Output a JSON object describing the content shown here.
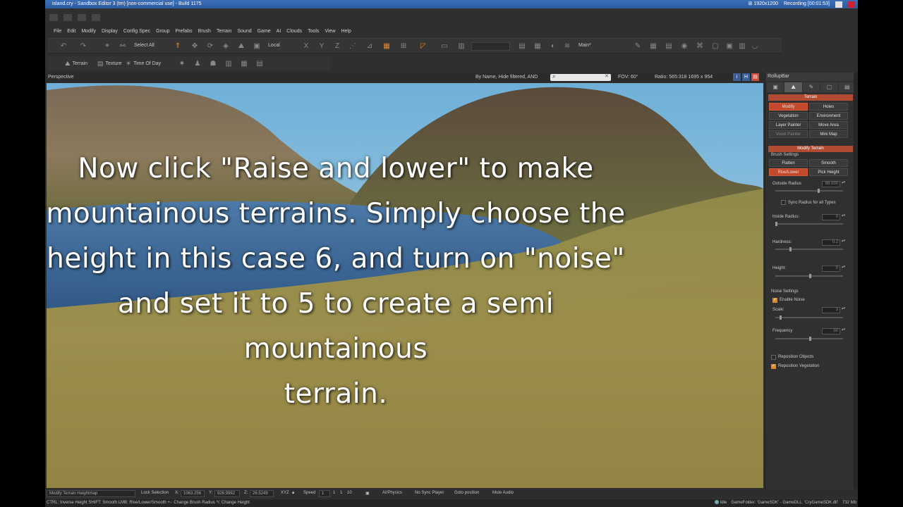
{
  "window": {
    "title": "island.cry - Sandbox Editor 3 (tm) [non-commercial use] - Build 1175",
    "resolution": "1920x1200",
    "recording": "Recording [00:01:53]"
  },
  "menu": [
    "File",
    "Edit",
    "Modify",
    "Display",
    "Config Spec",
    "Group",
    "Prefabs",
    "Brush",
    "Terrain",
    "Sound",
    "Game",
    "AI",
    "Clouds",
    "Tools",
    "View",
    "Help"
  ],
  "toolbar": {
    "select_all": "Select All",
    "coord_space": "Local",
    "layer": "Main*"
  },
  "toolbar2": {
    "terrain": "Terrain",
    "texture": "Texture",
    "time_of_day": "Time Of Day"
  },
  "viewport": {
    "mode": "Perspective",
    "filter": "By Name, Hide filtered, AND",
    "fov": "FOV:   60°",
    "ratio": "Ratio:  565:318    1695 x 954",
    "btn_i": "i",
    "btn_h": "H",
    "btn_v": "▤"
  },
  "tutorial_text": "Now click \"Raise and lower\" to make\nmountainous terrains. Simply choose the\nheight in this case 6, and turn on \"noise\"\nand set it to 5 to create a semi\nmountainous\nterrain.",
  "rollup": {
    "title": "RollupBar",
    "tabs": [
      "▣",
      "⛰",
      "✎",
      "▢",
      "▤"
    ],
    "section_terrain": "Terrain",
    "buttons_terrain": [
      "Modify",
      "Holes",
      "Vegetation",
      "Environment",
      "Layer Painter",
      "Move Area",
      "Voxel Painter",
      "Mini Map"
    ],
    "section_modify": "Modify Terrain",
    "brush_settings": "Brush Settings",
    "brush_buttons": [
      "Flatten",
      "Smooth",
      "Rise/Lower",
      "Pick Height"
    ],
    "outside_radius_label": "Outside Radius",
    "outside_radius_value": "66.000",
    "sync_radius_label": "Sync Radius for all Types",
    "inside_radius_label": "Inside Radius:",
    "inside_radius_value": "0",
    "hardness_label": "Hardness:",
    "hardness_value": "0.2",
    "height_label": "Height:",
    "height_value": "0",
    "noise_settings": "Noise Settings",
    "enable_noise": "Enable Noise",
    "scale_label": "Scale:",
    "scale_value": "3",
    "frequency_label": "Frequency",
    "frequency_value": "50",
    "reposition_objects": "Reposition Objects",
    "reposition_vegetation": "Reposition Vegetation"
  },
  "status": {
    "mode": "Modify Terrain Heightmap",
    "lock_selection": "Lock Selection",
    "x_label": "X:",
    "x_value": "1063.256",
    "y_label": "Y:",
    "y_value": "926.9982",
    "z_label": "Z:",
    "z_value": "26.5249",
    "xyz": "XYZ",
    "speed_label": "Speed",
    "speed_value": "1",
    "speed_a": "1",
    "speed_b": "10",
    "ai_physics": "AI/Physics",
    "no_sync": "No Sync Player",
    "goto": "Goto position",
    "mute": "Mute Audio"
  },
  "hint": {
    "text": "CTRL: Inverse Height  SHIFT: Smooth  LMB: Rise/Lower/Smooth  +-: Change Brush Radius  */: Change Height",
    "idle": "Idle",
    "game_folder": "GameFolder: 'GameSDK' - GameDLL: 'CryGameSDK.dll'",
    "mem": "732 Mb"
  },
  "colors": {
    "accent": "#c2492b",
    "titlebar": "#2c5aa0",
    "highlight": "#e08a2c"
  }
}
